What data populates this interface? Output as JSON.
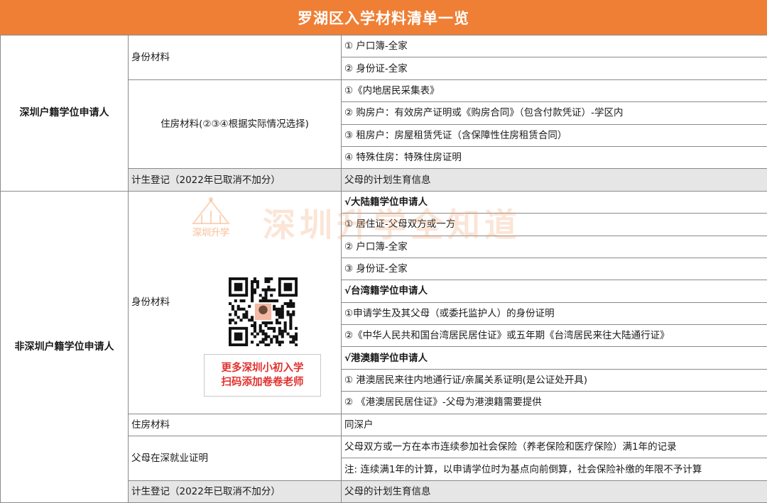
{
  "title": "罗湖区入学材料清单一览",
  "sections": {
    "shenzhen": {
      "applicant": "深圳户籍学位申请人",
      "id_label": "身份材料",
      "id_items": [
        "① 户口簿-全家",
        "② 身份证-全家"
      ],
      "housing_label": "住房材料(②③④根据实际情况选择)",
      "housing_items": [
        "①《内地居民采集表》",
        "② 购房户：有效房产证明或《购房合同》（包含付款凭证）-学区内",
        "③ 租房户：房屋租赁凭证（含保障性住房租赁合同）",
        "④ 特殊住房：特殊住房证明"
      ],
      "family_label": "计生登记（2022年已取消不加分）",
      "family_value": "父母的计划生育信息"
    },
    "non_shenzhen": {
      "applicant": "非深圳户籍学位申请人",
      "id_label": "身份材料",
      "id_items": [
        "√大陆籍学位申请人",
        "① 居住证-父母双方或一方",
        "② 户口簿-全家",
        "③ 身份证-全家",
        "√台湾籍学位申请人",
        "①申请学生及其父母（或委托监护人）的身份证明",
        "②《中华人民共和国台湾居民居住证》或五年期《台湾居民来往大陆通行证》",
        "√港澳籍学位申请人",
        "① 港澳居民来往内地通行证/亲属关系证明(是公证处开具)",
        "② 《港澳居民居住证》-父母为港澳籍需要提供"
      ],
      "housing_label": "住房材料",
      "housing_value": "同深户",
      "employment_label": "父母在深就业证明",
      "employment_items": [
        "父母双方或一方在本市连续参加社会保险（养老保险和医疗保险）满1年的记录",
        "注: 连续满1年的计算，以申请学位时为基点向前倒算，社会保险补缴的年限不予计算"
      ],
      "family_label": "计生登记（2022年已取消不加分）",
      "family_value": "父母的计划生育信息"
    }
  },
  "promo": {
    "line1": "更多深圳小初入学",
    "line2": "扫码添加卷卷老师"
  },
  "watermark": "深圳升学全知道",
  "logo_text": "深圳升学",
  "colors": {
    "header_bg": "#ef7f35",
    "promo_text": "#e0322f",
    "grey_row": "#e6e6e6"
  }
}
